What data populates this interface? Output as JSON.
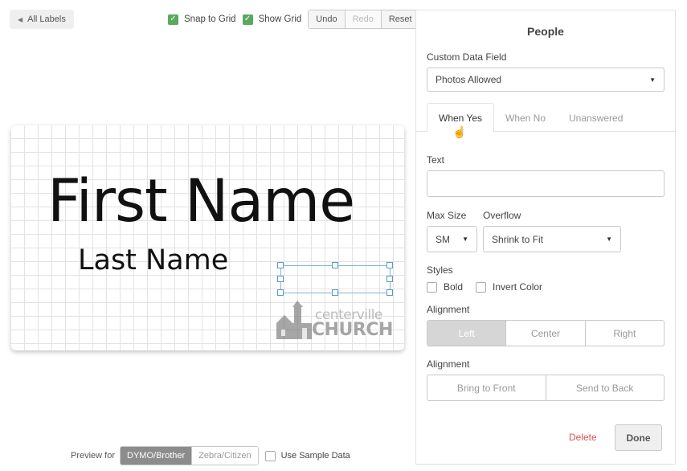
{
  "header": {
    "back_label": "All Labels",
    "snap_to_grid": "Snap to Grid",
    "show_grid": "Show Grid",
    "undo": "Undo",
    "redo": "Redo",
    "reset": "Reset"
  },
  "label": {
    "first_name": "First Name",
    "last_name": "Last Name",
    "logo_top": "centerville",
    "logo_bottom": "CHURCH"
  },
  "preview": {
    "label": "Preview for",
    "options": [
      "DYMO/Brother",
      "Zebra/Citizen"
    ],
    "selected": "DYMO/Brother",
    "sample_data": "Use Sample Data"
  },
  "panel": {
    "title": "People",
    "custom_field_label": "Custom Data Field",
    "custom_field_value": "Photos Allowed",
    "tabs": [
      "When Yes",
      "When No",
      "Unanswered"
    ],
    "active_tab": "When Yes",
    "text_label": "Text",
    "text_value": "",
    "max_size_label": "Max Size",
    "max_size_value": "SM",
    "overflow_label": "Overflow",
    "overflow_value": "Shrink to Fit",
    "styles_label": "Styles",
    "bold": "Bold",
    "invert_color": "Invert Color",
    "alignment_label": "Alignment",
    "alignment_options": [
      "Left",
      "Center",
      "Right"
    ],
    "alignment_selected": "Left",
    "layer_label": "Alignment",
    "layer_options": [
      "Bring to Front",
      "Send to Back"
    ],
    "delete": "Delete",
    "done": "Done"
  },
  "colors": {
    "check_green": "#5aa95c",
    "delete_red": "#d9534f",
    "selection_blue": "#5a9cc7",
    "segment_active": "#8c8c8c"
  }
}
